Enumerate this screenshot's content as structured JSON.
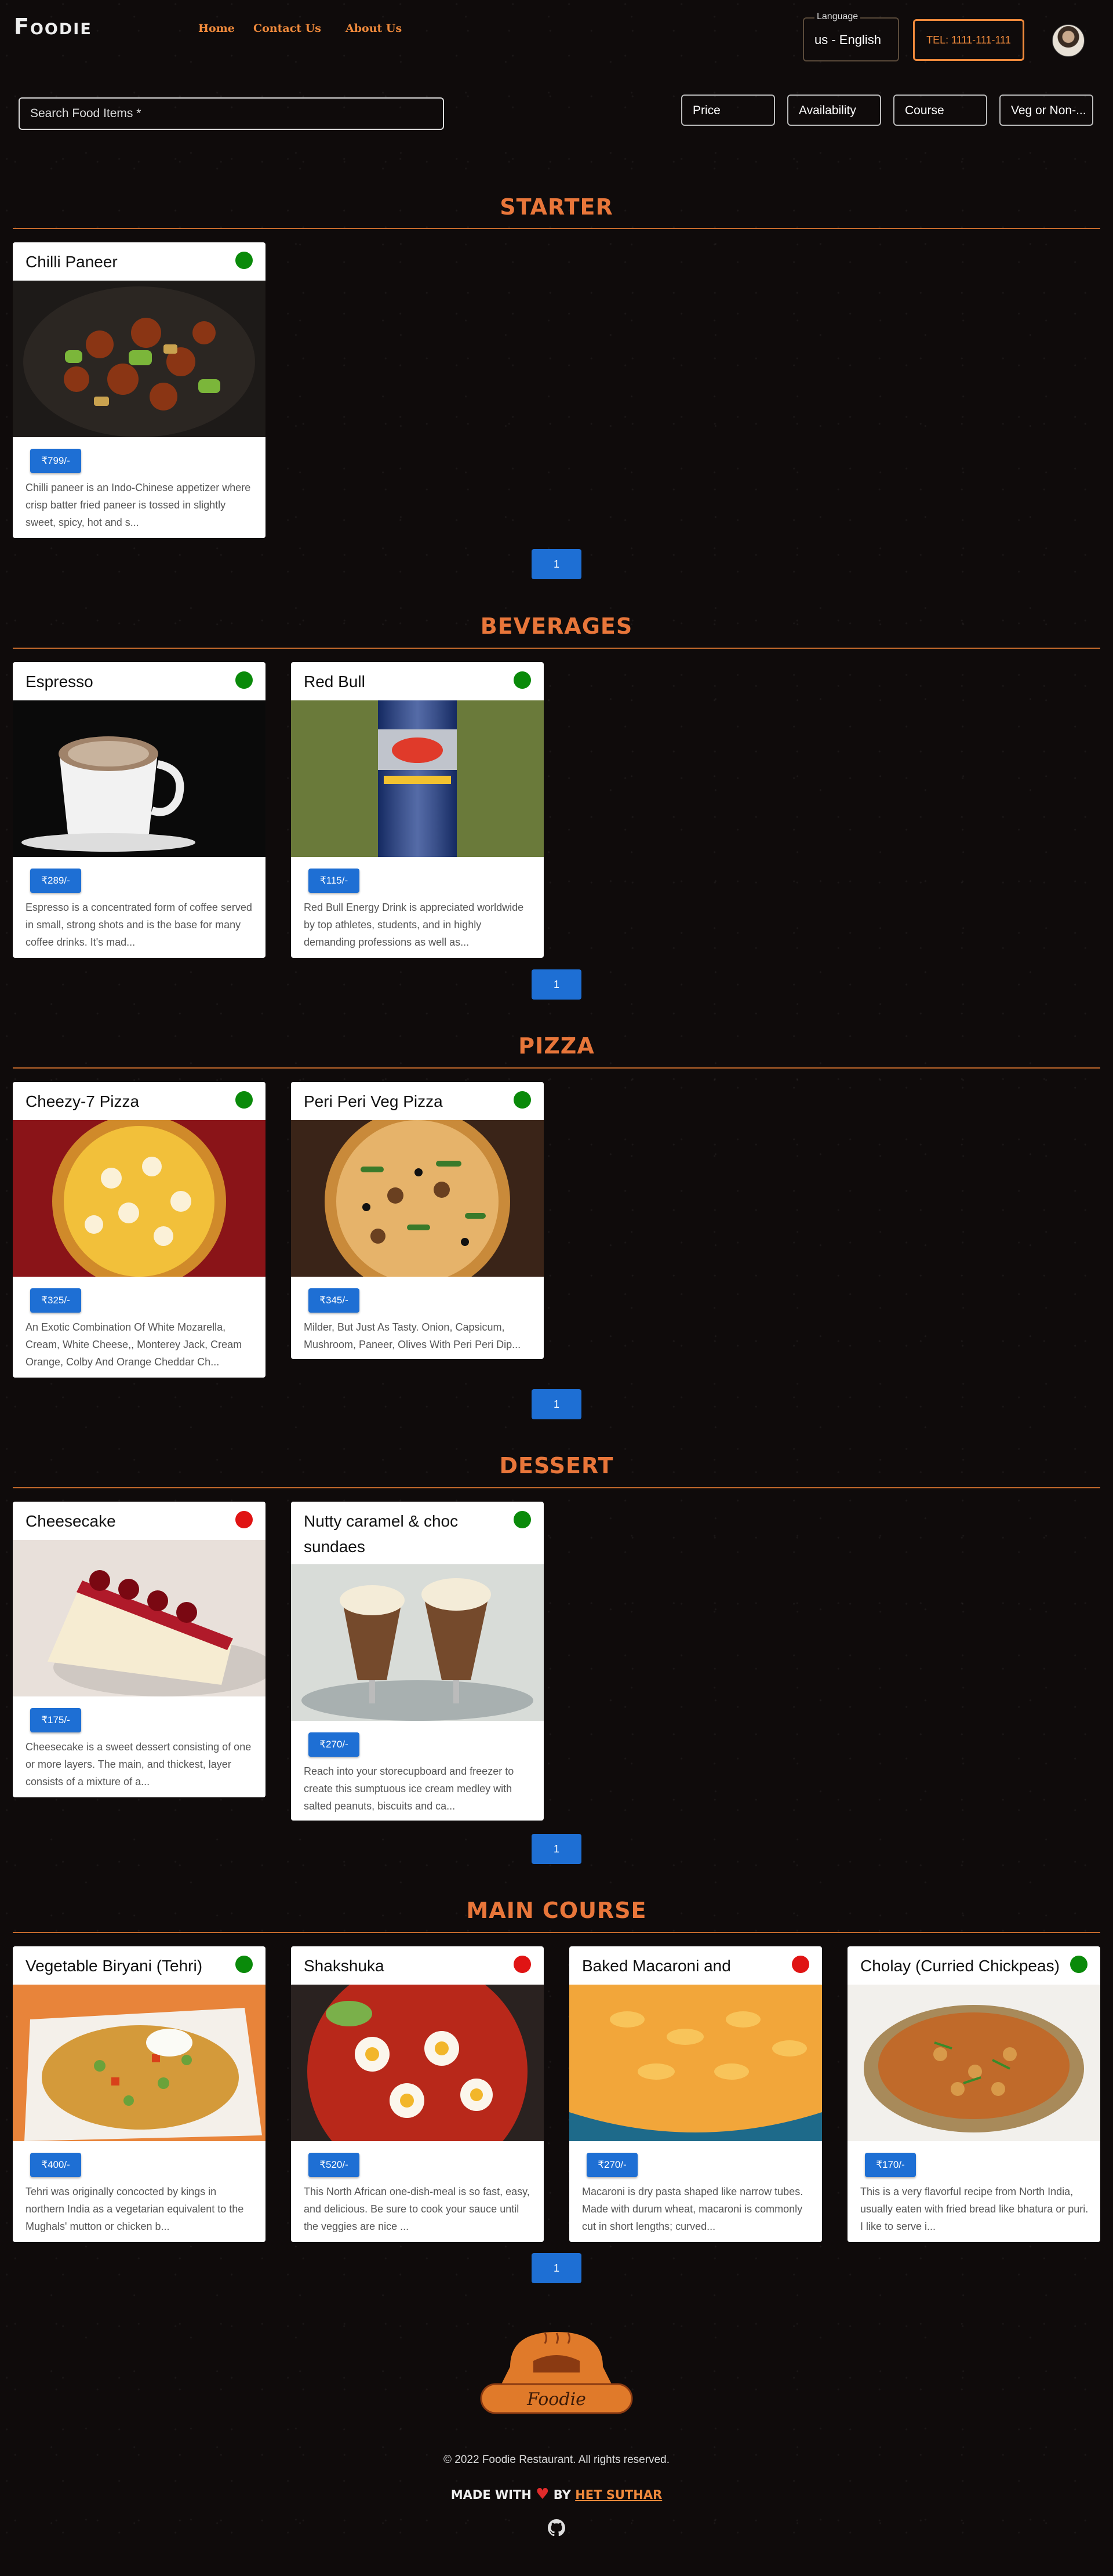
{
  "nav": {
    "logo": "Foodie",
    "links": [
      "Home",
      "Contact Us",
      "About Us"
    ],
    "language_label": "Language",
    "language_value": "us - English",
    "tel": "TEL: 1111-111-111"
  },
  "search": {
    "placeholder": "Search Food Items *"
  },
  "filters": [
    "Price",
    "Availability",
    "Course",
    "Veg or Non-..."
  ],
  "sections": [
    {
      "title": "STARTER",
      "items": [
        {
          "name": "Chilli Paneer",
          "price": "₹799/-",
          "veg": true,
          "desc": "Chilli paneer is an Indo-Chinese appetizer where crisp batter fried paneer is tossed in slightly sweet, spicy, hot and s..."
        }
      ]
    },
    {
      "title": "BEVERAGES",
      "items": [
        {
          "name": "Espresso",
          "price": "₹289/-",
          "veg": true,
          "desc": "Espresso is a concentrated form of coffee served in small, strong shots and is the base for many coffee drinks. It's mad..."
        },
        {
          "name": "Red Bull",
          "price": "₹115/-",
          "veg": true,
          "desc": "Red Bull Energy Drink is appreciated worldwide by top athletes, students, and in highly demanding professions as well as..."
        }
      ]
    },
    {
      "title": "PIZZA",
      "items": [
        {
          "name": "Cheezy-7 Pizza",
          "price": "₹325/-",
          "veg": true,
          "desc": "An Exotic Combination Of White Mozarella, Cream, White Cheese,, Monterey Jack, Cream Orange, Colby And Orange Cheddar Ch..."
        },
        {
          "name": "Peri Peri Veg Pizza",
          "price": "₹345/-",
          "veg": true,
          "desc": "Milder, But Just As Tasty. Onion, Capsicum, Mushroom, Paneer, Olives With Peri Peri Dip..."
        }
      ]
    },
    {
      "title": "DESSERT",
      "items": [
        {
          "name": "Cheesecake",
          "price": "₹175/-",
          "veg": false,
          "desc": "Cheesecake is a sweet dessert consisting of one or more layers. The main, and thickest, layer consists of a mixture of a..."
        },
        {
          "name": "Nutty caramel & choc sundaes",
          "price": "₹270/-",
          "veg": true,
          "desc": "Reach into your storecupboard and freezer to create this sumptuous ice cream medley with salted peanuts, biscuits and ca..."
        }
      ]
    },
    {
      "title": "MAIN COURSE",
      "items": [
        {
          "name": "Vegetable Biryani (Tehri)",
          "price": "₹400/-",
          "veg": true,
          "desc": "Tehri was originally concocted by kings in northern India as a vegetarian equivalent to the Mughals' mutton or chicken b..."
        },
        {
          "name": "Shakshuka",
          "price": "₹520/-",
          "veg": false,
          "desc": "This North African one-dish-meal is so fast, easy, and delicious. Be sure to cook your sauce until the veggies are nice ..."
        },
        {
          "name": "Baked Macaroni and Cheese",
          "price": "₹270/-",
          "veg": false,
          "desc": "Macaroni is dry pasta shaped like narrow tubes. Made with durum wheat, macaroni is commonly cut in short lengths; curved..."
        },
        {
          "name": "Cholay (Curried Chickpeas)",
          "price": "₹170/-",
          "veg": true,
          "desc": "This is a very flavorful recipe from North India, usually eaten with fried bread like bhatura or puri. I like to serve i..."
        }
      ]
    }
  ],
  "pagination_label": "1",
  "footer": {
    "logo_text": "Foodie",
    "copyright": "© 2022 Foodie Restaurant. All rights reserved.",
    "made_with": "MADE WITH",
    "by": "BY",
    "author": "HET SUTHAR"
  },
  "colors": {
    "accent": "#f08a3c",
    "price_badge": "#1e6fd4",
    "veg": "#0a8a0a",
    "nonveg": "#e01414"
  }
}
